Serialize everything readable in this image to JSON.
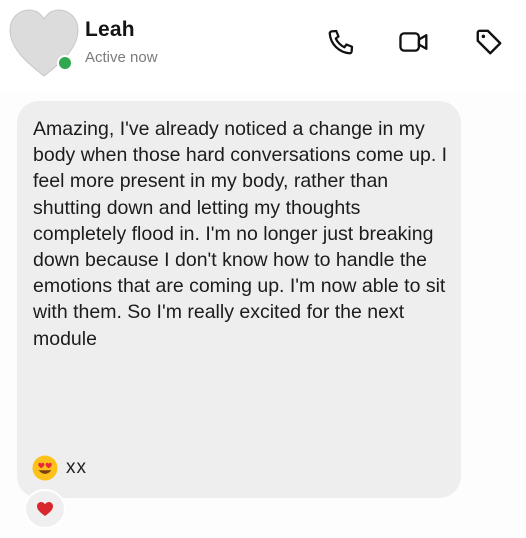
{
  "contact": {
    "name": "Leah",
    "status": "Active now",
    "status_color": "#2fa84f"
  },
  "header_actions": [
    {
      "icon": "phone-icon"
    },
    {
      "icon": "video-camera-icon"
    },
    {
      "icon": "tag-icon"
    }
  ],
  "message": {
    "text": "Amazing, I've already noticed a change in my body when those hard conversations come up. I feel more present in my body, rather than shutting down and letting my thoughts completely flood in. I'm no longer just breaking down because I don't know how to handle the emotions that are coming up. I'm now able to sit with them. So I'm really excited for the next module",
    "emoji": "heart-eyes-emoji",
    "suffix": "xx",
    "bubble_color": "#eeeeee"
  },
  "reaction": {
    "emoji": "red-heart-icon",
    "color": "#d9262c"
  }
}
